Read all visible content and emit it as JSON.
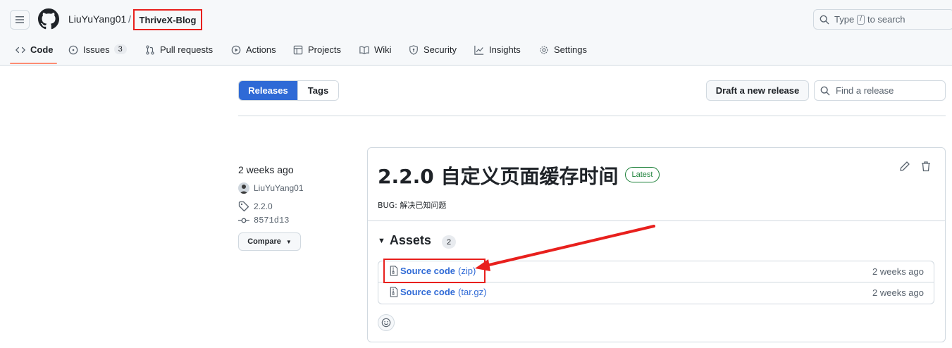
{
  "header": {
    "owner": "LiuYuYang01",
    "separator": "/",
    "repo": "ThriveX-Blog",
    "search_prefix": "Type",
    "search_key": "/",
    "search_suffix": "to search"
  },
  "tabs": [
    {
      "label": "Code",
      "icon": "code-icon"
    },
    {
      "label": "Issues",
      "icon": "issue-icon",
      "count": "3"
    },
    {
      "label": "Pull requests",
      "icon": "pull-request-icon"
    },
    {
      "label": "Actions",
      "icon": "play-icon"
    },
    {
      "label": "Projects",
      "icon": "table-icon"
    },
    {
      "label": "Wiki",
      "icon": "book-icon"
    },
    {
      "label": "Security",
      "icon": "shield-icon"
    },
    {
      "label": "Insights",
      "icon": "graph-icon"
    },
    {
      "label": "Settings",
      "icon": "gear-icon"
    }
  ],
  "subnav": {
    "releases_label": "Releases",
    "tags_label": "Tags",
    "draft_label": "Draft a new release",
    "find_placeholder": "Find a release"
  },
  "release": {
    "date": "2 weeks ago",
    "author": "LiuYuYang01",
    "tag": "2.2.0",
    "commit": "8571d13",
    "compare_label": "Compare",
    "title": "2.2.0 自定义页面缓存时间",
    "badge": "Latest",
    "notes": "BUG: 解决已知问题"
  },
  "assets": {
    "heading": "Assets",
    "count": "2",
    "items": [
      {
        "name": "Source code",
        "ext": "(zip)",
        "time": "2 weeks ago"
      },
      {
        "name": "Source code",
        "ext": "(tar.gz)",
        "time": "2 weeks ago"
      }
    ]
  },
  "colors": {
    "accent": "#2f6ad6",
    "annotation": "#e8201d",
    "success": "#1a7f37",
    "tab_underline": "#fd8c73"
  }
}
